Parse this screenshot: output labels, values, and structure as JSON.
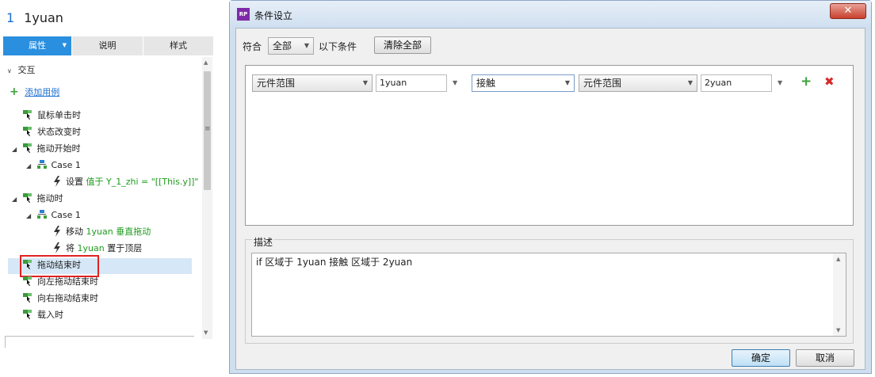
{
  "left": {
    "title_num": "1",
    "title_name": "1yuan",
    "tabs": [
      "属性",
      "说明",
      "样式"
    ],
    "section": "交互",
    "add_case": "添加用例",
    "events": {
      "click": "鼠标单击时",
      "state_change": "状态改变时",
      "drag_start": "拖动开始时",
      "drag_start_case": "Case 1",
      "drag_start_action_verb": "设置",
      "drag_start_action_detail": "值于 Y_1_zhi = \"[[This.y]]\"",
      "drag": "拖动时",
      "drag_case": "Case 1",
      "drag_action1_verb": "移动",
      "drag_action1_detail": "1yuan 垂直拖动",
      "drag_action2_verb": "将",
      "drag_action2_target": "1yuan",
      "drag_action2_rest": "置于顶层",
      "drag_end": "拖动结束时",
      "swipe_left": "向左拖动结束时",
      "swipe_right": "向右拖动结束时",
      "load": "载入时"
    }
  },
  "dialog": {
    "app_icon": "RP",
    "title": "条件设立",
    "close": "✕",
    "match_label": "符合",
    "match_value": "全部",
    "match_suffix": "以下条件",
    "clear_all": "清除全部",
    "condition_row": {
      "scope1": "元件范围",
      "target1": "1yuan",
      "operator": "接触",
      "scope2": "元件范围",
      "target2": "2yuan"
    },
    "desc_label": "描述",
    "desc_text": "if 区域于 1yuan 接触 区域于 2yuan",
    "ok": "确定",
    "cancel": "取消"
  },
  "colors": {
    "accent_tab": "#2a8fdf",
    "selection": "#d6e8f7",
    "highlight_box": "#e02222",
    "green_text": "#1d9a1d",
    "dialog_frame": "#cfdff0"
  }
}
